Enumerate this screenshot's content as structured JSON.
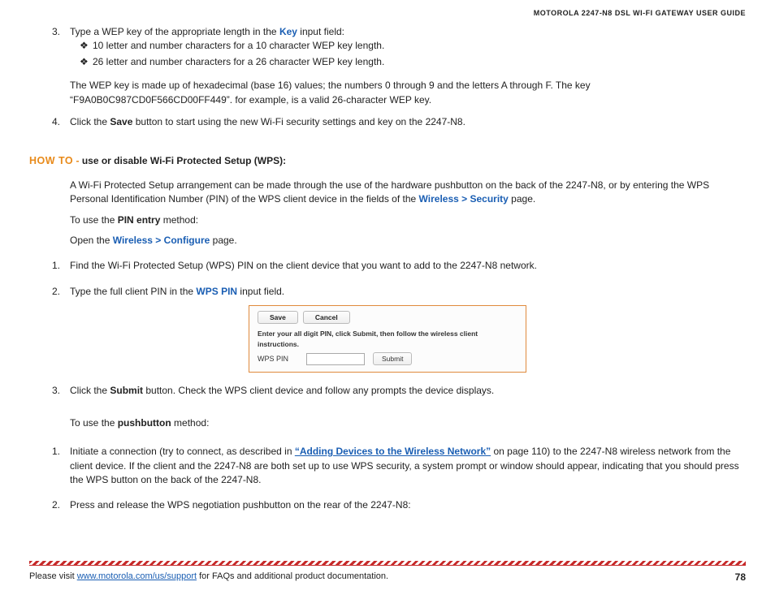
{
  "header": "MOTOROLA 2247-N8 DSL WI-FI GATEWAY USER GUIDE",
  "step3": {
    "num": "3.",
    "prefix": "Type a WEP key of the appropriate length in the ",
    "key_label": "Key",
    "suffix": " input field:",
    "b1_mark": "❖",
    "b1_text": "10 letter and number characters for a 10 character WEP key length.",
    "b2_mark": "❖",
    "b2_text": "26 letter and number characters for a 26 character WEP key length.",
    "explain": "The WEP key is made up of hexadecimal (base 16) values; the numbers 0 through 9 and the letters A through F.   The key “F9A0B0C987CD0F566CD00FF449”. for example, is a valid 26-character WEP key."
  },
  "step4": {
    "num": "4.",
    "prefix": "Click the ",
    "save": "Save",
    "suffix": " button to start using the new Wi-Fi security settings and key on the 2247-N8."
  },
  "howto": {
    "label": "HOW TO",
    "dash": " - ",
    "topic": "use or disable Wi-Fi Protected Setup (WPS):"
  },
  "intro": {
    "line1_a": "A Wi-Fi Protected Setup arrangement can be made through the use of the hardware pushbutton on the back of the 2247-N8, or by entering the WPS Personal Identification Number (PIN) of the WPS client device in the fields of the ",
    "line1_link": "Wireless > Security",
    "line1_b": " page.",
    "pin_a": "To use the ",
    "pin_b": "PIN entry",
    "pin_c": " method:",
    "open_a": "Open the ",
    "open_link": "Wireless > Configure",
    "open_b": " page."
  },
  "pin_steps": {
    "s1": {
      "num": "1.",
      "text": "Find the Wi-Fi Protected Setup (WPS) PIN on the client device that you want to add to the 2247-N8 network."
    },
    "s2": {
      "num": "2.",
      "prefix": "Type the full client PIN in the ",
      "wps": "WPS PIN",
      "suffix": " input field."
    },
    "s3": {
      "num": "3.",
      "prefix": "Click the ",
      "submit": "Submit",
      "suffix": " button. Check the WPS client device and follow any prompts the device displays."
    }
  },
  "screenshot": {
    "save": "Save",
    "cancel": "Cancel",
    "instr": "Enter your all digit PIN, click Submit, then follow the wireless client instructions.",
    "label": "WPS PIN",
    "submit": "Submit"
  },
  "push": {
    "intro_a": "To use the ",
    "intro_b": "pushbutton",
    "intro_c": " method:",
    "s1": {
      "num": "1.",
      "a": "Initiate a connection (try to connect, as described in ",
      "link": "“Adding Devices to the Wireless Network”",
      "b": " on page 110) to the 2247-N8 wireless network from the client device. If the client and the 2247-N8 are both set up to use WPS security, a system prompt or window should appear, indicating that you should press the WPS button on the back of the 2247-N8."
    },
    "s2": {
      "num": "2.",
      "text": "Press and release the WPS negotiation pushbutton on the rear of the 2247-N8:"
    }
  },
  "footer": {
    "prefix": "Please visit ",
    "url": "www.motorola.com/us/support",
    "suffix": " for FAQs and additional product documentation.",
    "page": "78"
  }
}
